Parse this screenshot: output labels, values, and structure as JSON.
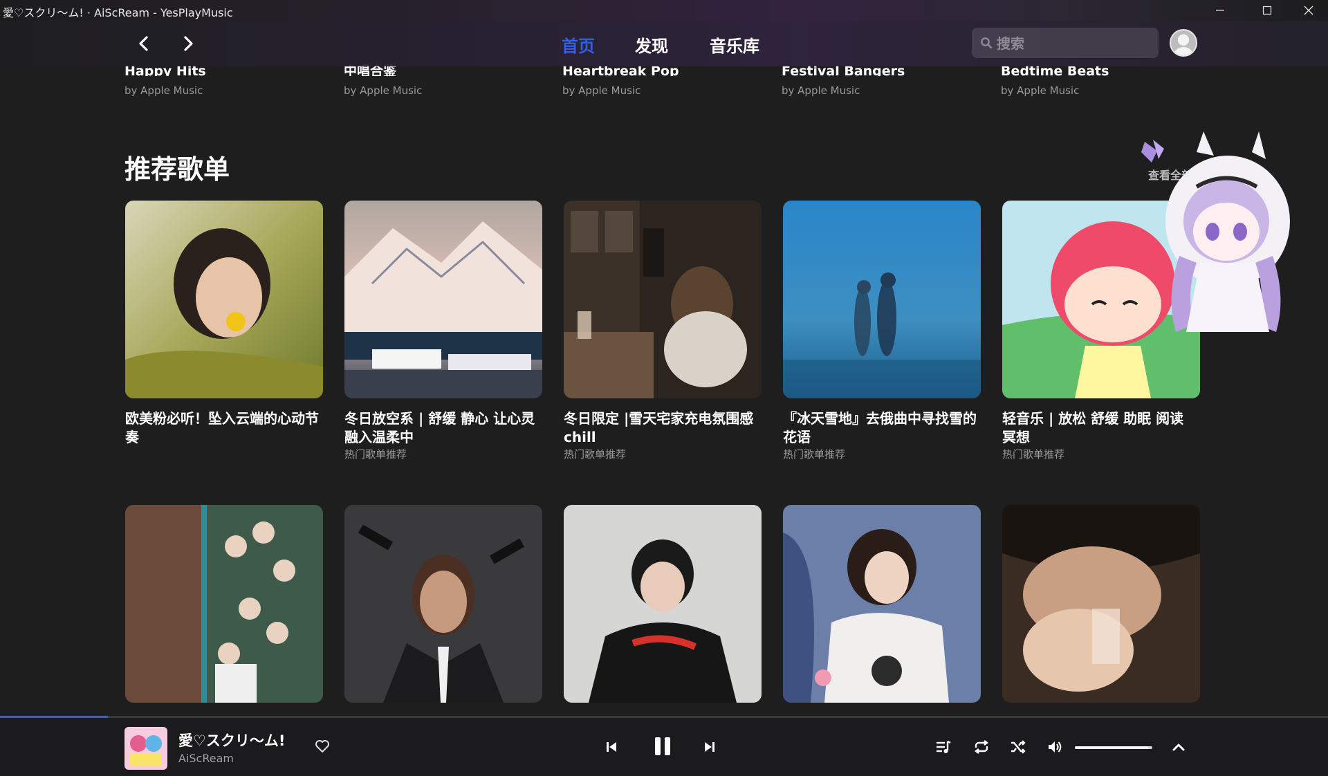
{
  "window": {
    "title": "愛♡スクリ～ム! · AiScReam - YesPlayMusic"
  },
  "nav": {
    "tabs": [
      {
        "label": "首页",
        "active": true
      },
      {
        "label": "发现",
        "active": false
      },
      {
        "label": "音乐库",
        "active": false
      }
    ],
    "search_placeholder": "搜索"
  },
  "previous_row": [
    {
      "title": "Happy Hits",
      "subtitle": "by Apple Music"
    },
    {
      "title": "中唱合鉴",
      "subtitle": "by Apple Music"
    },
    {
      "title": "Heartbreak Pop",
      "subtitle": "by Apple Music"
    },
    {
      "title": "Festival Bangers",
      "subtitle": "by Apple Music"
    },
    {
      "title": "Bedtime Beats",
      "subtitle": "by Apple Music"
    }
  ],
  "section": {
    "title": "推荐歌单",
    "see_all": "查看全部"
  },
  "playlists": [
    {
      "title": "欧美粉必听！坠入云端的心动节奏",
      "subtitle": ""
    },
    {
      "title": "冬日放空系 | 舒缓 静心 让心灵融入温柔中",
      "subtitle": "热门歌单推荐"
    },
    {
      "title": "冬日限定 |雪天宅家充电氛围感chill",
      "subtitle": "热门歌单推荐"
    },
    {
      "title": "『冰天雪地』去俄曲中寻找雪的花语",
      "subtitle": "热门歌单推荐"
    },
    {
      "title": "轻音乐 | 放松 舒缓 助眠 阅读 冥想",
      "subtitle": "热门歌单推荐"
    }
  ],
  "player": {
    "title": "愛♡スクリ～ム!",
    "artist": "AiScReam",
    "progress": 0.081,
    "volume": 0.95
  },
  "colors": {
    "accent": "#335eea",
    "background": "#1e1e1f"
  }
}
